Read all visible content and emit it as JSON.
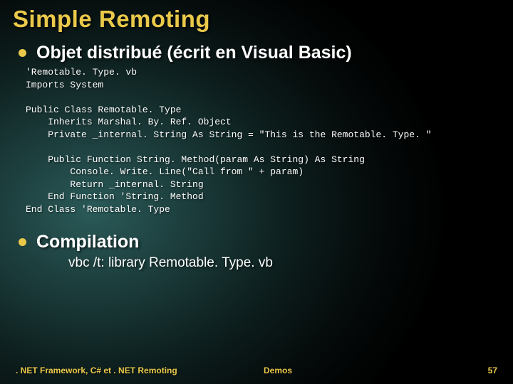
{
  "title": "Simple Remoting",
  "bullet1": "Objet distribué (écrit en Visual Basic)",
  "code": "'Remotable. Type. vb\nImports System\n\nPublic Class Remotable. Type\n    Inherits Marshal. By. Ref. Object\n    Private _internal. String As String = \"This is the Remotable. Type. \"\n\n    Public Function String. Method(param As String) As String\n        Console. Write. Line(\"Call from \" + param)\n        Return _internal. String\n    End Function 'String. Method\nEnd Class 'Remotable. Type",
  "bullet2": "Compilation",
  "subline": "vbc /t: library Remotable. Type. vb",
  "footer": {
    "left": ". NET Framework, C# et . NET Remoting",
    "center": "Demos",
    "right": "57"
  }
}
